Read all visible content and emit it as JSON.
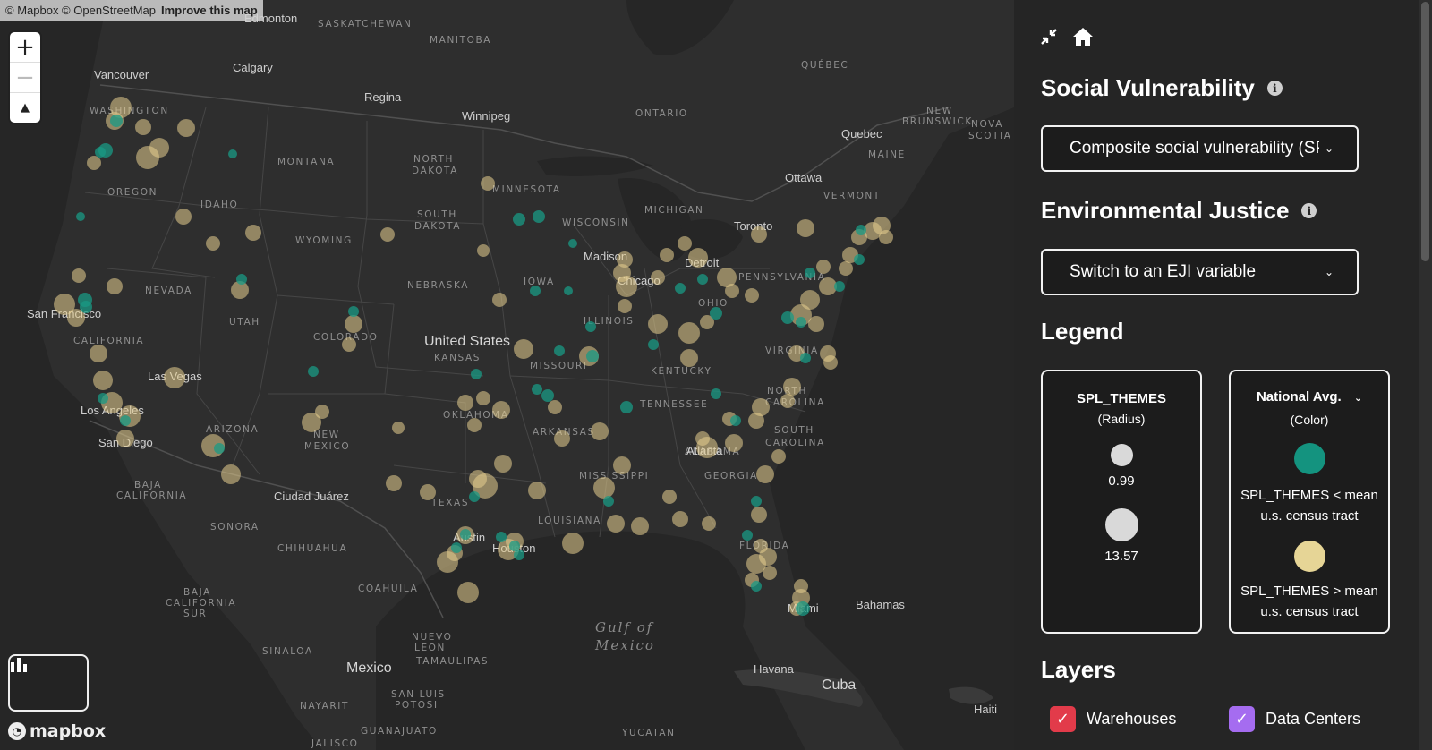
{
  "map": {
    "attribution": {
      "text": "© Mapbox © OpenStreetMap",
      "link": "Improve this map"
    },
    "zoom": {
      "in": "+",
      "out": "−",
      "compass": "▲"
    },
    "logo_text": "mapbox",
    "region_labels": [
      "SASKATCHEWAN",
      "MANITOBA",
      "QUÉBEC",
      "ONTARIO",
      "NEW BRUNSWICK",
      "NOVA SCOTIA",
      "MAINE",
      "VERMONT",
      "WASHINGTON",
      "MONTANA",
      "NORTH DAKOTA",
      "MINNESOTA",
      "OREGON",
      "IDAHO",
      "WYOMING",
      "SOUTH DAKOTA",
      "WISCONSIN",
      "MICHIGAN",
      "NEVADA",
      "NEBRASKA",
      "IOWA",
      "UTAH",
      "COLORADO",
      "KANSAS",
      "MISSOURI",
      "ILLINOIS",
      "OHIO",
      "PENNSYLVANIA",
      "CALIFORNIA",
      "ARIZONA",
      "NEW MEXICO",
      "OKLAHOMA",
      "ARKANSAS",
      "TENNESSEE",
      "KENTUCKY",
      "VIRGINIA",
      "NORTH CAROLINA",
      "SOUTH CAROLINA",
      "TEXAS",
      "MISSISSIPPI",
      "ALABAMA",
      "GEORGIA",
      "LOUISIANA",
      "FLORIDA",
      "BAJA CALIFORNIA",
      "SONORA",
      "CHIHUAHUA",
      "COAHUILA",
      "BAJA CALIFORNIA SUR",
      "NUEVO LEON",
      "TAMAULIPAS",
      "SINALOA",
      "NAYARIT",
      "SAN LUIS POTOSI",
      "GUANAJUATO",
      "JALISCO",
      "YUCATAN"
    ],
    "city_labels": [
      "Edmonton",
      "Calgary",
      "Vancouver",
      "Regina",
      "Winnipeg",
      "Quebec",
      "Ottawa",
      "Toronto",
      "Detroit",
      "Chicago",
      "Madison",
      "San Francisco",
      "Los Angeles",
      "San Diego",
      "Las Vegas",
      "Ciudad Juárez",
      "Austin",
      "Houston",
      "Atlanta",
      "Miami",
      "Bahamas",
      "Havana",
      "Cuba",
      "Haiti"
    ],
    "country_labels": [
      "United States",
      "Mexico"
    ],
    "water_labels": [
      "Gulf of",
      "Mexico"
    ],
    "point_colors": {
      "below": "#1a9a84",
      "above": "#e8d08f"
    }
  },
  "panel": {
    "social_title": "Social Vulnerability",
    "social_select": "Composite social vulnerability (SP",
    "eji_title": "Environmental Justice",
    "eji_select": "Switch to an EJI variable",
    "legend_title": "Legend",
    "radius_box": {
      "title": "SPL_THEMES",
      "subtitle": "(Radius)",
      "small_value": "0.99",
      "large_value": "13.57",
      "dot_color": "#d9d9d9"
    },
    "color_box": {
      "title": "National Avg.",
      "subtitle": "(Color)",
      "below_label_1": "SPL_THEMES < mean",
      "below_label_2": "u.s. census tract",
      "above_label_1": "SPL_THEMES > mean",
      "above_label_2": "u.s. census tract",
      "below_color": "#14937f",
      "above_color": "#e6d596"
    },
    "layers_title": "Layers",
    "layers": [
      {
        "label": "Warehouses",
        "checked": true,
        "color": "#e23b4a"
      },
      {
        "label": "Data Centers",
        "checked": true,
        "color": "#a56cf0"
      }
    ]
  }
}
